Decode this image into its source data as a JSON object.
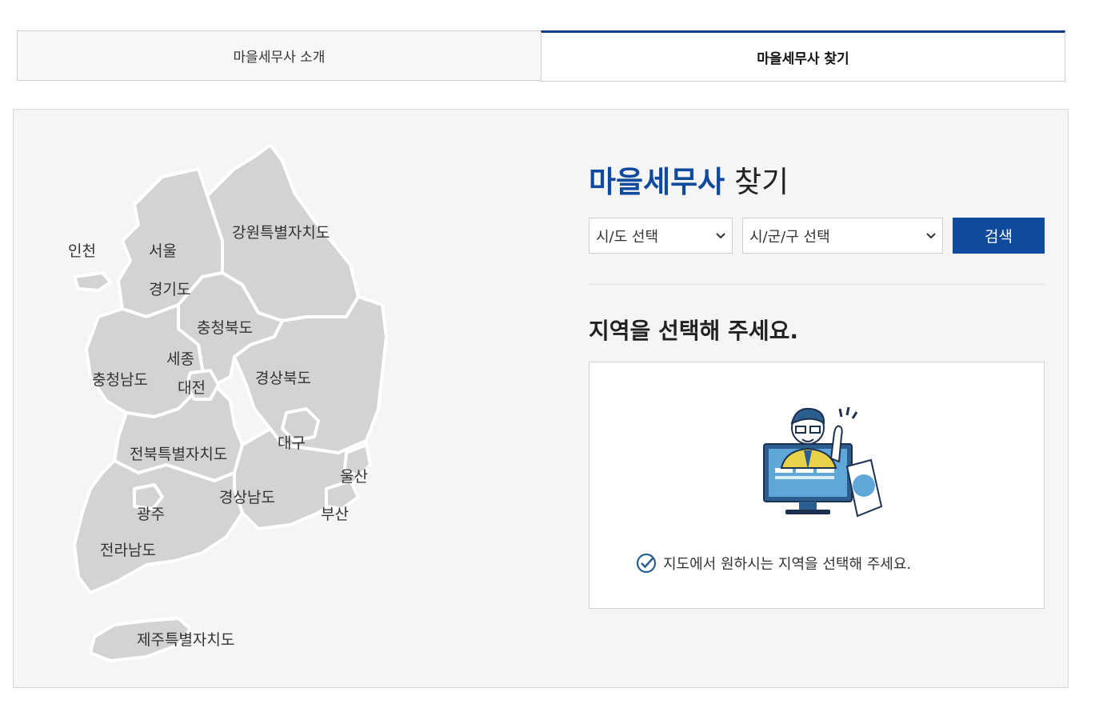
{
  "tabs": {
    "intro": "마을세무사 소개",
    "find": "마을세무사 찾기"
  },
  "map": {
    "regions": {
      "incheon": "인천",
      "seoul": "서울",
      "gangwon": "강원특별자치도",
      "gyeonggi": "경기도",
      "chungbuk": "충청북도",
      "sejong": "세종",
      "chungnam": "충청남도",
      "daejeon": "대전",
      "gyeongbuk": "경상북도",
      "daegu": "대구",
      "jeonbuk": "전북특별자치도",
      "ulsan": "울산",
      "gyeongnam": "경상남도",
      "gwangju": "광주",
      "busan": "부산",
      "jeonnam": "전라남도",
      "jeju": "제주특별자치도"
    },
    "colors": {
      "land": "#d3d3d3",
      "border": "#ffffff"
    }
  },
  "search": {
    "title_accent": "마을세무사",
    "title_rest": "찾기",
    "sido_select": "시/도 선택",
    "sigungu_select": "시/군/구 선택",
    "search_button": "검색",
    "accent_color": "#0f4a9e"
  },
  "result": {
    "heading": "지역을 선택해 주세요.",
    "guide_text": "지도에서 원하시는 지역을 선택해 주세요.",
    "illustration": "tax-advisor-monitor-illustration"
  }
}
